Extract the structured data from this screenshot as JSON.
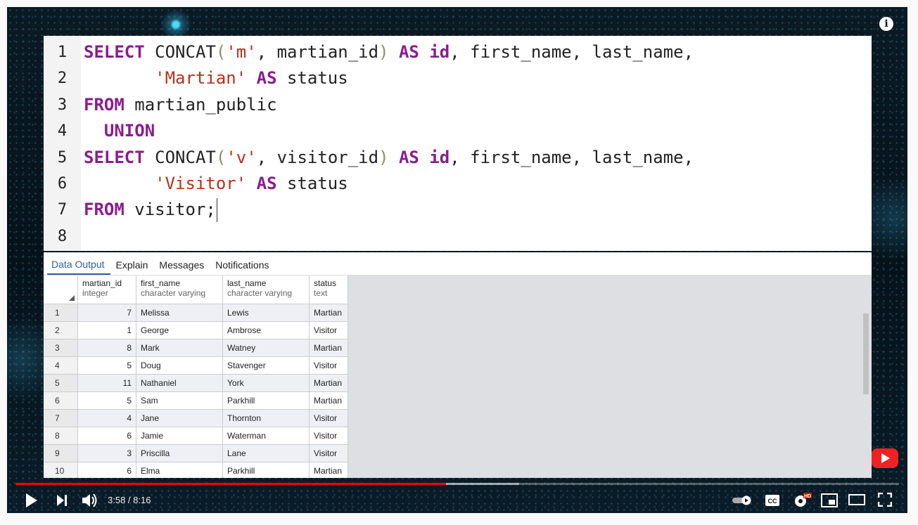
{
  "editor": {
    "line_numbers": [
      "1",
      "2",
      "3",
      "4",
      "5",
      "6",
      "7",
      "8"
    ],
    "lines": [
      [
        {
          "t": "kw",
          "v": "SELECT"
        },
        {
          "t": "",
          "v": " CONCAT"
        },
        {
          "t": "paren",
          "v": "("
        },
        {
          "t": "str",
          "v": "'m'"
        },
        {
          "t": "",
          "v": ", martian_id"
        },
        {
          "t": "paren",
          "v": ")"
        },
        {
          "t": "",
          "v": " "
        },
        {
          "t": "kw",
          "v": "AS"
        },
        {
          "t": "",
          "v": " "
        },
        {
          "t": "kw",
          "v": "id"
        },
        {
          "t": "",
          "v": ", first_name, last_name,"
        }
      ],
      [
        {
          "t": "",
          "v": "       "
        },
        {
          "t": "str",
          "v": "'Martian'"
        },
        {
          "t": "",
          "v": " "
        },
        {
          "t": "kw",
          "v": "AS"
        },
        {
          "t": "",
          "v": " status"
        }
      ],
      [
        {
          "t": "kw",
          "v": "FROM"
        },
        {
          "t": "",
          "v": " martian_public"
        }
      ],
      [
        {
          "t": "",
          "v": "  "
        },
        {
          "t": "kw",
          "v": "UNION"
        }
      ],
      [
        {
          "t": "kw",
          "v": "SELECT"
        },
        {
          "t": "",
          "v": " CONCAT"
        },
        {
          "t": "paren",
          "v": "("
        },
        {
          "t": "str",
          "v": "'v'"
        },
        {
          "t": "",
          "v": ", visitor_id"
        },
        {
          "t": "paren",
          "v": ")"
        },
        {
          "t": "",
          "v": " "
        },
        {
          "t": "kw",
          "v": "AS"
        },
        {
          "t": "",
          "v": " "
        },
        {
          "t": "kw",
          "v": "id"
        },
        {
          "t": "",
          "v": ", first_name, last_name,"
        }
      ],
      [
        {
          "t": "",
          "v": "       "
        },
        {
          "t": "str",
          "v": "'Visitor'"
        },
        {
          "t": "",
          "v": " "
        },
        {
          "t": "kw",
          "v": "AS"
        },
        {
          "t": "",
          "v": " status"
        }
      ],
      [
        {
          "t": "kw",
          "v": "FROM"
        },
        {
          "t": "",
          "v": " visitor;"
        }
      ],
      []
    ]
  },
  "output": {
    "tabs": [
      "Data Output",
      "Explain",
      "Messages",
      "Notifications"
    ],
    "active_tab": "Data Output",
    "columns": [
      {
        "name": "martian_id",
        "type": "integer"
      },
      {
        "name": "first_name",
        "type": "character varying"
      },
      {
        "name": "last_name",
        "type": "character varying"
      },
      {
        "name": "status",
        "type": "text"
      }
    ],
    "rows": [
      [
        "1",
        "7",
        "Melissa",
        "Lewis",
        "Martian"
      ],
      [
        "2",
        "1",
        "George",
        "Ambrose",
        "Visitor"
      ],
      [
        "3",
        "8",
        "Mark",
        "Watney",
        "Martian"
      ],
      [
        "4",
        "5",
        "Doug",
        "Stavenger",
        "Visitor"
      ],
      [
        "5",
        "11",
        "Nathaniel",
        "York",
        "Martian"
      ],
      [
        "6",
        "5",
        "Sam",
        "Parkhill",
        "Martian"
      ],
      [
        "7",
        "4",
        "Jane",
        "Thornton",
        "Visitor"
      ],
      [
        "8",
        "6",
        "Jamie",
        "Waterman",
        "Visitor"
      ],
      [
        "9",
        "3",
        "Priscilla",
        "Lane",
        "Visitor"
      ],
      [
        "10",
        "6",
        "Elma",
        "Parkhill",
        "Martian"
      ]
    ]
  },
  "player": {
    "time": "3:58 / 8:16",
    "progress_played_fraction": 0.487,
    "progress_loaded_fraction": 0.57,
    "accent_color": "#ff0000",
    "icons": [
      "play-icon",
      "next-icon",
      "volume-icon",
      "autoplay-toggle-icon",
      "captions-icon",
      "settings-icon",
      "miniplayer-icon",
      "theater-icon",
      "fullscreen-icon",
      "info-icon"
    ],
    "settings_badge": "HD"
  }
}
